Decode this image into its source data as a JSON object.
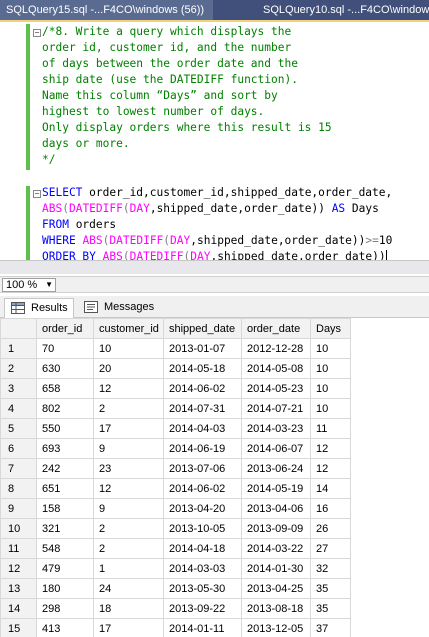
{
  "tabs": [
    {
      "label": "SQLQuery15.sql -...F4CO\\windows (56))"
    },
    {
      "label": "SQLQuery10.sql -...F4CO\\windows (5"
    }
  ],
  "editor": {
    "comment": [
      "/*8. Write a query which displays the",
      "order id, customer id, and the number",
      "of days between the order date and the",
      "ship date (use the DATEDIFF function).",
      "Name this column “Days” and sort by",
      "highest to lowest number of days.",
      "Only display orders where this result is 15",
      "days or more.",
      "*/"
    ],
    "sql": {
      "l1_kw": "SELECT",
      "l1_rest": " order_id,customer_id,shipped_date,order_date,",
      "l2_fn1": "ABS",
      "l2_p1": "(",
      "l2_fn2": "DATEDIFF",
      "l2_p2": "(",
      "l2_kw1": "DAY",
      "l2_rest": ",shipped_date,order_date)) ",
      "l2_kw2": "AS",
      "l2_alias": " Days",
      "l3_kw": "FROM",
      "l3_rest": " orders",
      "l4_kw": "WHERE",
      "l4_sp": " ",
      "l4_fn1": "ABS",
      "l4_p1": "(",
      "l4_fn2": "DATEDIFF",
      "l4_p2": "(",
      "l4_kw1": "DAY",
      "l4_rest": ",shipped_date,order_date))",
      "l4_op": ">=",
      "l4_num": "10",
      "l5_kw": "ORDER BY",
      "l5_sp": " ",
      "l5_fn1": "ABS",
      "l5_p1": "(",
      "l5_fn2": "DATEDIFF",
      "l5_p2": "(",
      "l5_kw1": "DAY",
      "l5_rest": ",shipped_date,order_date))"
    }
  },
  "zoom": {
    "value": "100 %"
  },
  "result_tabs": {
    "results": "Results",
    "messages": "Messages"
  },
  "grid": {
    "columns": [
      "order_id",
      "customer_id",
      "shipped_date",
      "order_date",
      "Days"
    ],
    "rows": [
      [
        "1",
        "70",
        "10",
        "2013-01-07",
        "2012-12-28",
        "10"
      ],
      [
        "2",
        "630",
        "20",
        "2014-05-18",
        "2014-05-08",
        "10"
      ],
      [
        "3",
        "658",
        "12",
        "2014-06-02",
        "2014-05-23",
        "10"
      ],
      [
        "4",
        "802",
        "2",
        "2014-07-31",
        "2014-07-21",
        "10"
      ],
      [
        "5",
        "550",
        "17",
        "2014-04-03",
        "2014-03-23",
        "11"
      ],
      [
        "6",
        "693",
        "9",
        "2014-06-19",
        "2014-06-07",
        "12"
      ],
      [
        "7",
        "242",
        "23",
        "2013-07-06",
        "2013-06-24",
        "12"
      ],
      [
        "8",
        "651",
        "12",
        "2014-06-02",
        "2014-05-19",
        "14"
      ],
      [
        "9",
        "158",
        "9",
        "2013-04-20",
        "2013-04-06",
        "16"
      ],
      [
        "10",
        "321",
        "2",
        "2013-10-05",
        "2013-09-09",
        "26"
      ],
      [
        "11",
        "548",
        "2",
        "2014-04-18",
        "2014-03-22",
        "27"
      ],
      [
        "12",
        "479",
        "1",
        "2014-03-03",
        "2014-01-30",
        "32"
      ],
      [
        "13",
        "180",
        "24",
        "2013-05-30",
        "2013-04-25",
        "35"
      ],
      [
        "14",
        "298",
        "18",
        "2013-09-22",
        "2013-08-18",
        "35"
      ],
      [
        "15",
        "413",
        "17",
        "2014-01-11",
        "2013-12-05",
        "37"
      ]
    ]
  },
  "colors": {
    "tab_bar": "#5a6b92",
    "comment": "#008000",
    "keyword": "#0000ff",
    "function": "#ff00ff",
    "change_margin": "#5cc04a"
  }
}
